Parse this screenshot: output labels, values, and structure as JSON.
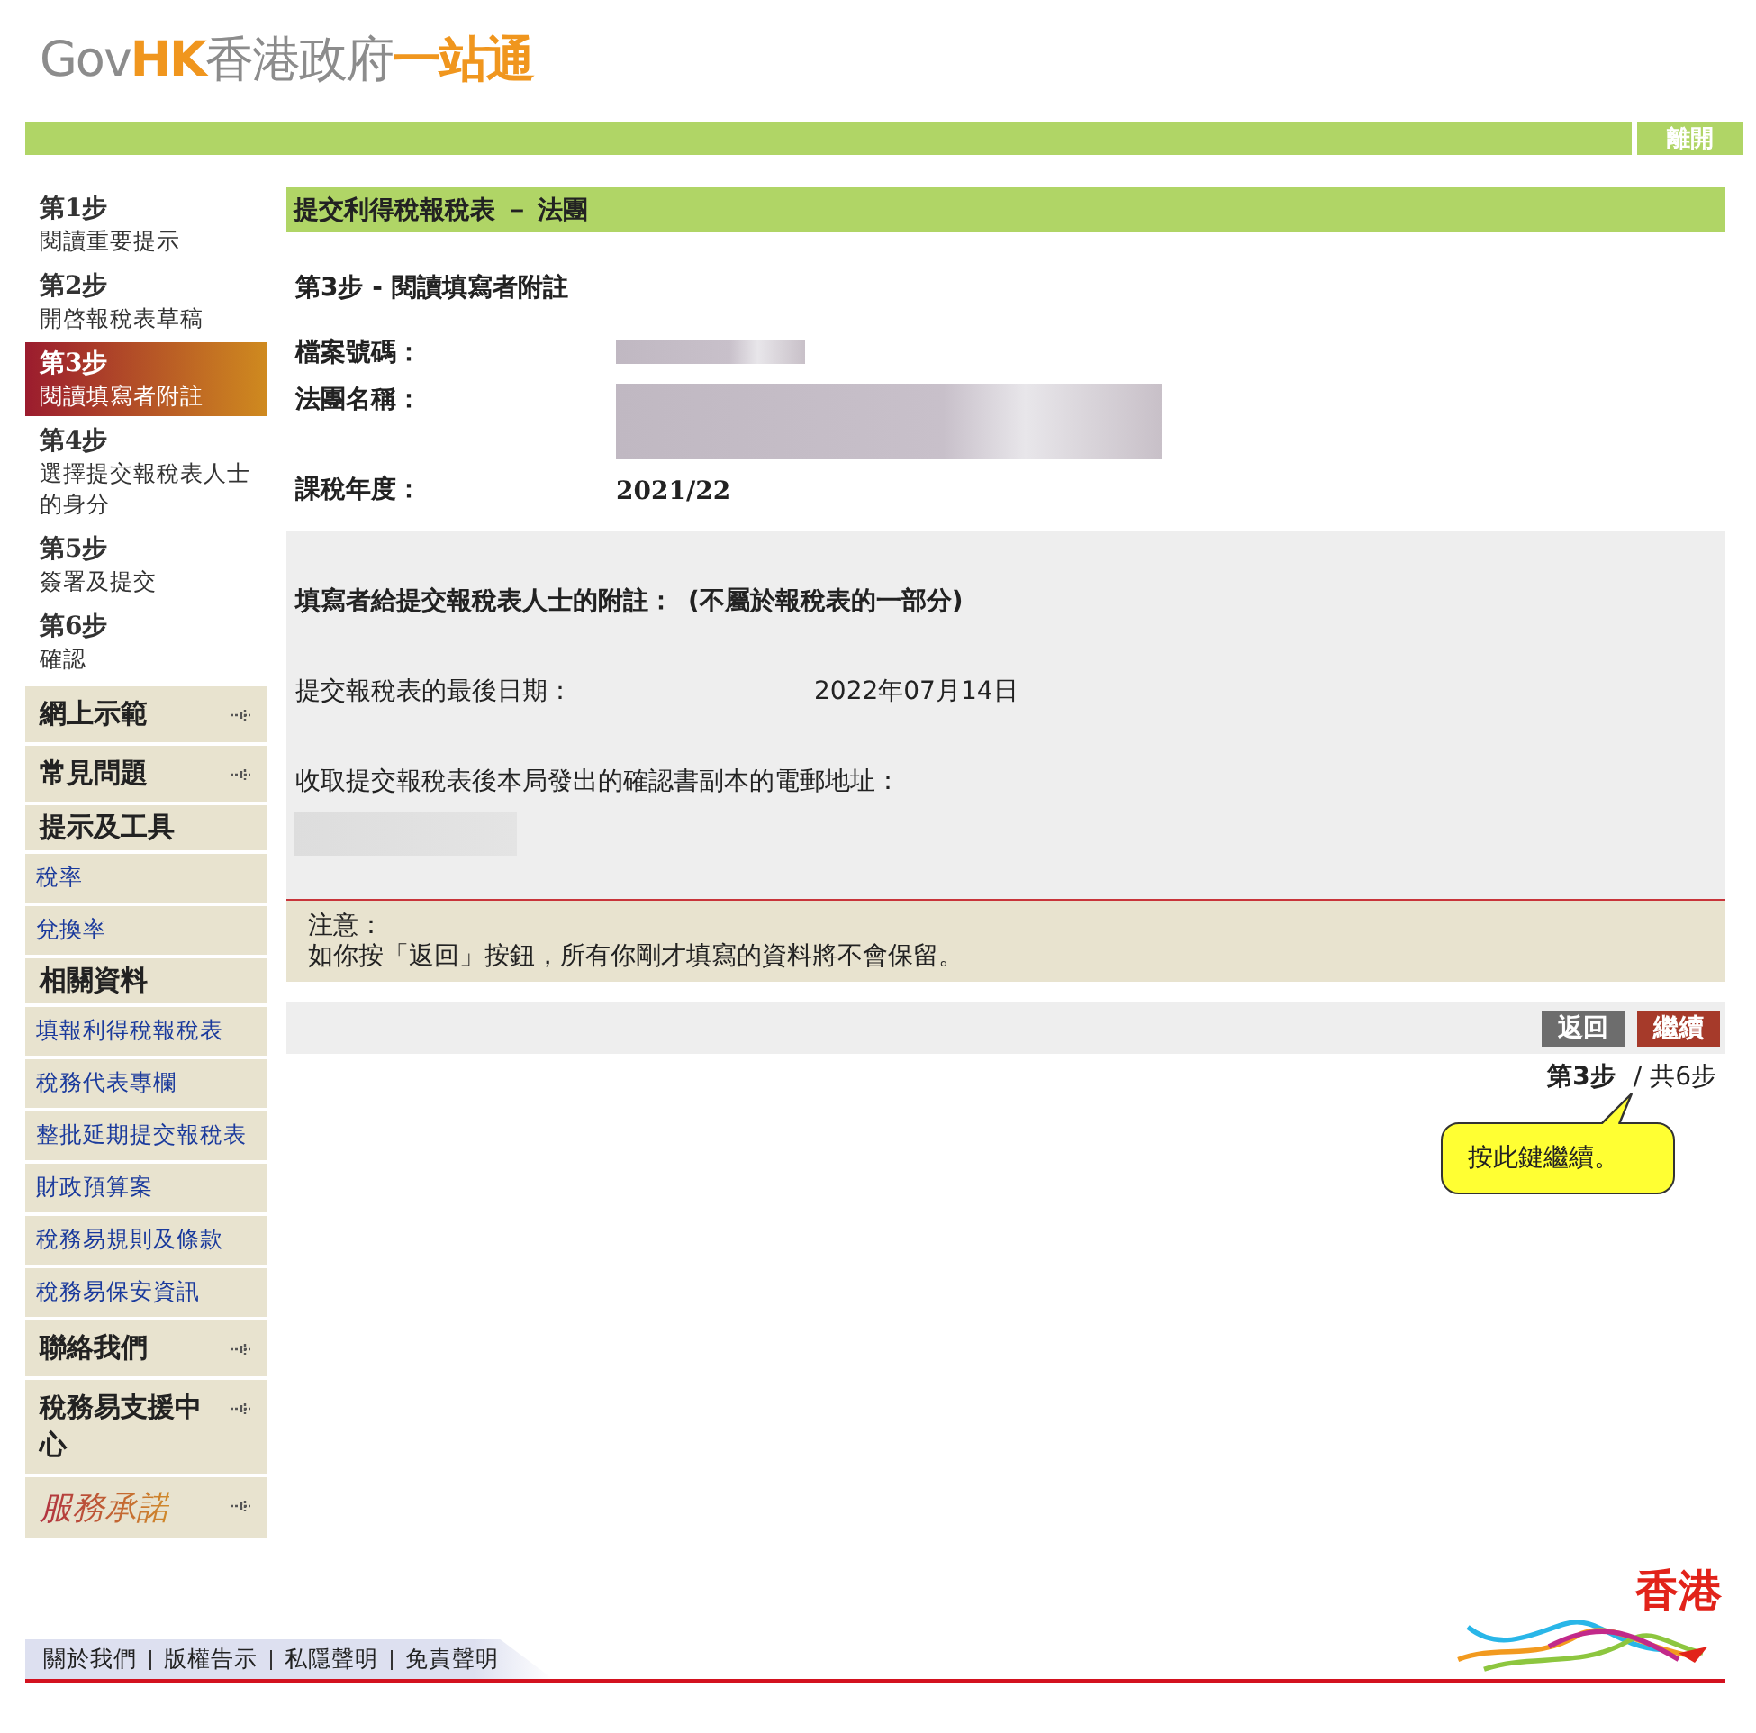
{
  "logo": {
    "parts": [
      {
        "text": "Gov",
        "kind": "plain"
      },
      {
        "text": "HK",
        "kind": "accent"
      },
      {
        "text": "香港政府",
        "kind": "plain"
      },
      {
        "text": "一站通",
        "kind": "accent"
      }
    ]
  },
  "exit_button": "離開",
  "steps": [
    {
      "title": "第1步",
      "label": "閱讀重要提示",
      "selected": false
    },
    {
      "title": "第2步",
      "label": "開啓報稅表草稿",
      "selected": false
    },
    {
      "title": "第3步",
      "label": "閱讀填寫者附註",
      "selected": true
    },
    {
      "title": "第4步",
      "label": "選擇提交報稅表人士的身分",
      "selected": false
    },
    {
      "title": "第5步",
      "label": "簽署及提交",
      "selected": false
    },
    {
      "title": "第6步",
      "label": "確認",
      "selected": false
    }
  ],
  "menu": [
    {
      "label": "網上示範",
      "kind": "expandable"
    },
    {
      "label": "常見問題",
      "kind": "expandable"
    },
    {
      "label": "提示及工具",
      "kind": "heading"
    },
    {
      "label": "稅率",
      "kind": "link"
    },
    {
      "label": "兌換率",
      "kind": "link"
    },
    {
      "label": "相關資料",
      "kind": "heading"
    },
    {
      "label": "填報利得稅報稅表",
      "kind": "link"
    },
    {
      "label": "稅務代表專欄",
      "kind": "link"
    },
    {
      "label": "整批延期提交報稅表",
      "kind": "link"
    },
    {
      "label": "財政預算案",
      "kind": "link"
    },
    {
      "label": "稅務易規則及條款",
      "kind": "link"
    },
    {
      "label": "稅務易保安資訊",
      "kind": "link"
    },
    {
      "label": "聯絡我們",
      "kind": "expandable"
    },
    {
      "label": "稅務易支援中心",
      "kind": "expandable"
    },
    {
      "label": "服務承諾",
      "kind": "emblem"
    }
  ],
  "page_title": "提交利得稅報稅表 － 法團",
  "step_heading": "第3步 - 閱讀填寫者附註",
  "fields": [
    {
      "label": "檔案號碼：",
      "kind": "redacted-short"
    },
    {
      "label": "法團名稱：",
      "kind": "redacted-long"
    },
    {
      "label": "課稅年度：",
      "kind": "text",
      "value": "2021/22"
    }
  ],
  "notes_panel": {
    "heading": "填寫者給提交報稅表人士的附註：",
    "heading_note": "(不屬於報稅表的一部分)",
    "deadline_label": "提交報稅表的最後日期：",
    "deadline_value": "2022年07月14日",
    "email_label": "收取提交報稅表後本局發出的確認書副本的電郵地址："
  },
  "notice": {
    "title": "注意：",
    "text": "如你按「返回」按鈕，所有你剛才填寫的資料將不會保留。"
  },
  "buttons": [
    {
      "label": "返回",
      "kind": "back"
    },
    {
      "label": "繼續",
      "kind": "next"
    }
  ],
  "progress": {
    "current": "第3步",
    "total": "/ 共6步"
  },
  "callout": "按此鍵繼續。",
  "footer_links": [
    "關於我們",
    "版權告示",
    "私隱聲明",
    "免責聲明"
  ],
  "brand_mark": "香港"
}
